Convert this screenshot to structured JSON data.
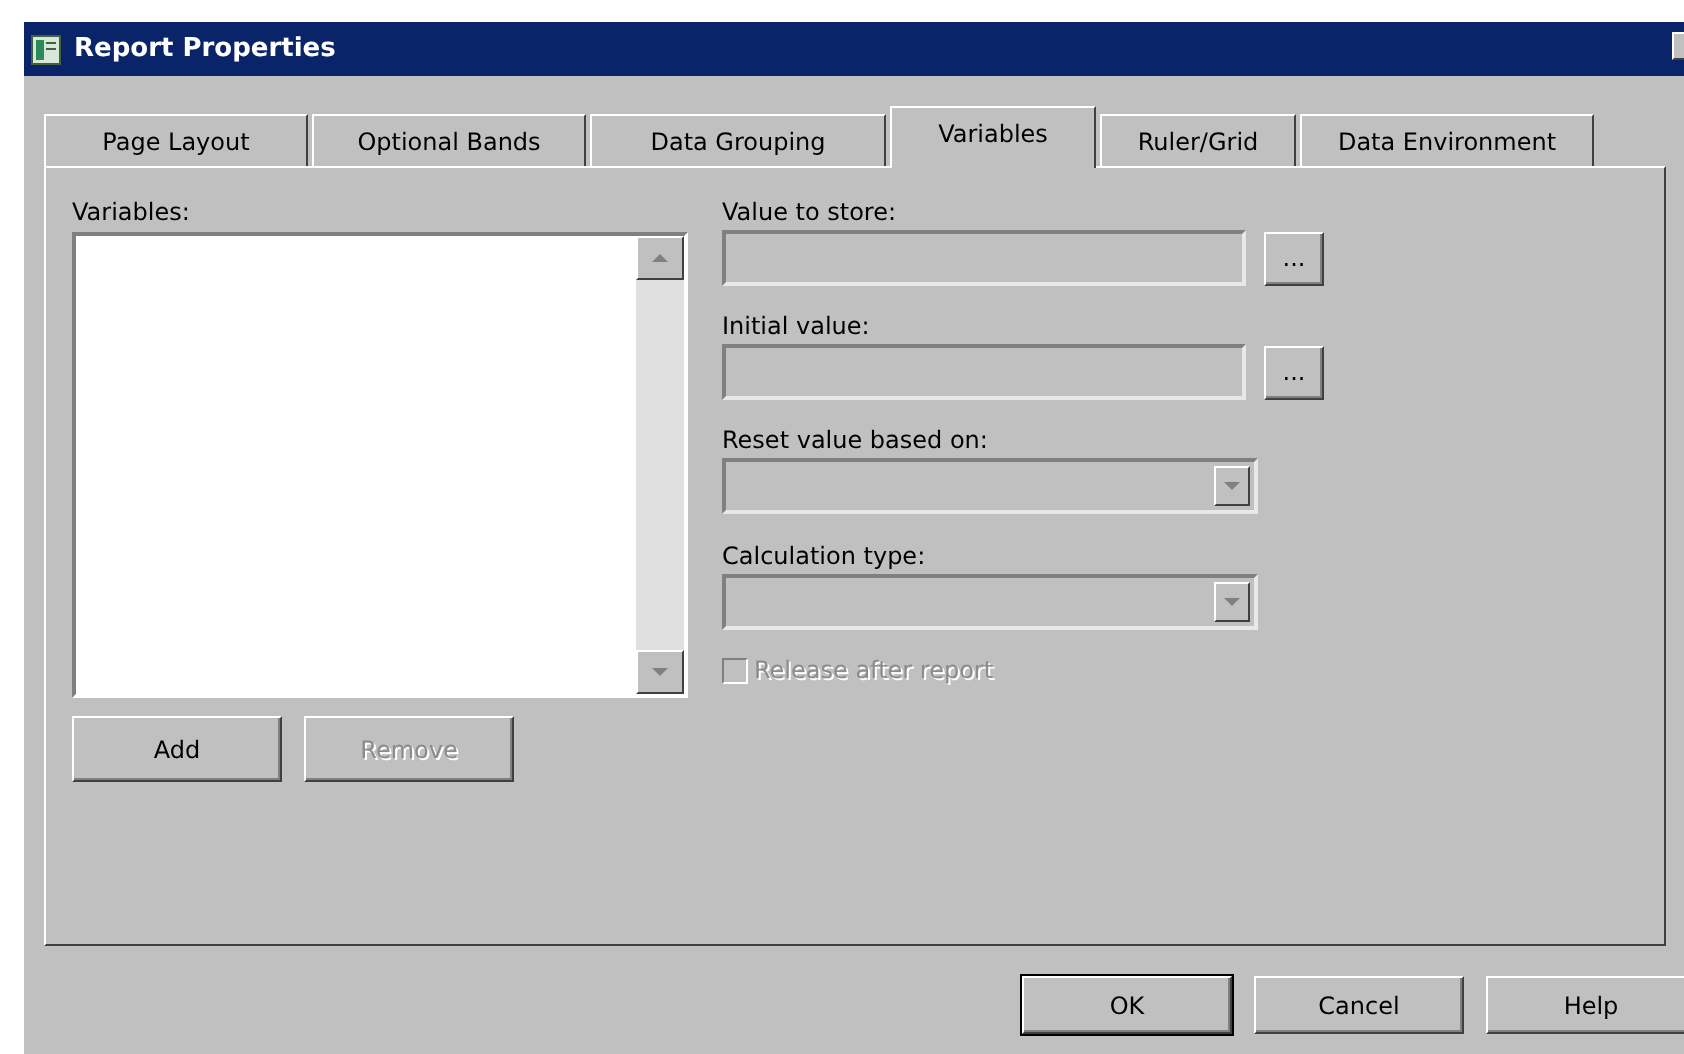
{
  "window": {
    "title": "Report Properties"
  },
  "tabs": [
    {
      "label": "Page Layout",
      "selected": false
    },
    {
      "label": "Optional Bands",
      "selected": false
    },
    {
      "label": "Data Grouping",
      "selected": false
    },
    {
      "label": "Variables",
      "selected": true
    },
    {
      "label": "Ruler/Grid",
      "selected": false
    },
    {
      "label": "Data Environment",
      "selected": false
    }
  ],
  "variables": {
    "label": "Variables:",
    "buttons": [
      {
        "label": "Add",
        "disabled": false
      },
      {
        "label": "Remove",
        "disabled": true
      }
    ]
  },
  "fields": [
    {
      "kind": "text",
      "label": "Value to store:",
      "disabled": true,
      "browse": "..."
    },
    {
      "kind": "text",
      "label": "Initial value:",
      "disabled": true,
      "browse": "..."
    },
    {
      "kind": "combo",
      "label": "Reset value based on:",
      "disabled": true
    },
    {
      "kind": "combo",
      "label": "Calculation type:",
      "disabled": true
    }
  ],
  "checkbox": {
    "label": "Release after report",
    "checked": false,
    "disabled": true
  },
  "footer_buttons": [
    {
      "label": "OK",
      "default": true
    },
    {
      "label": "Cancel",
      "default": false
    },
    {
      "label": "Help",
      "default": false
    }
  ]
}
